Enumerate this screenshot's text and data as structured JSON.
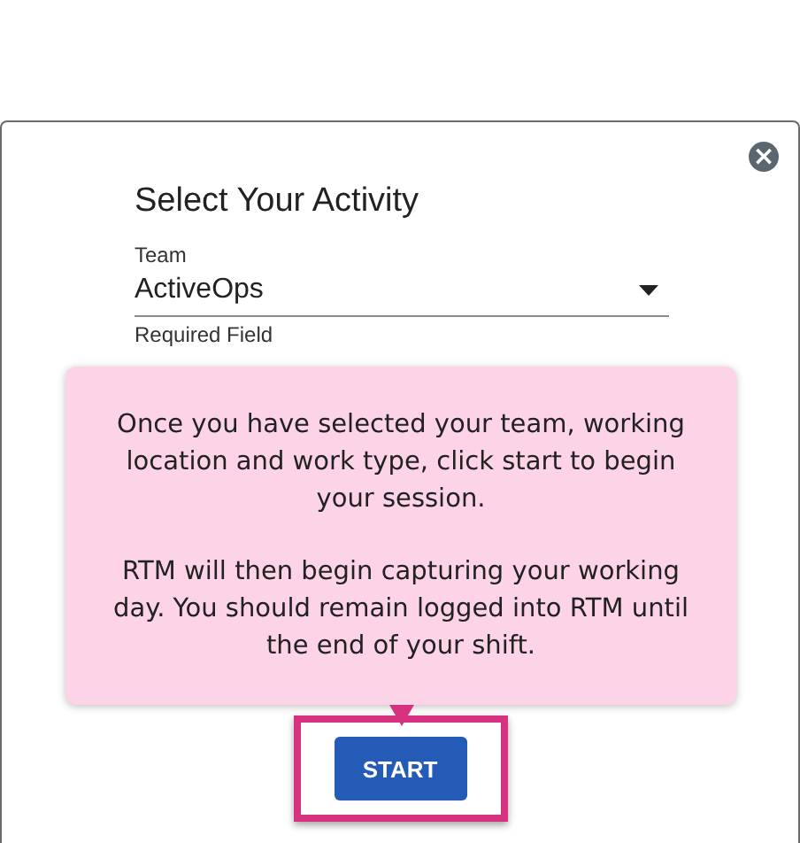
{
  "dialog": {
    "title": "Select Your Activity",
    "close_button": "×",
    "team_field": {
      "label": "Team",
      "value": "ActiveOps",
      "helper": "Required Field"
    },
    "start_button": {
      "label": "START",
      "highlighted": true
    }
  },
  "tooltip": {
    "paragraphs": [
      "Once you have selected your team, working location and work type, click start to begin your session.",
      "RTM will then begin capturing your working day. You should remain logged into RTM until the end of your shift."
    ]
  }
}
